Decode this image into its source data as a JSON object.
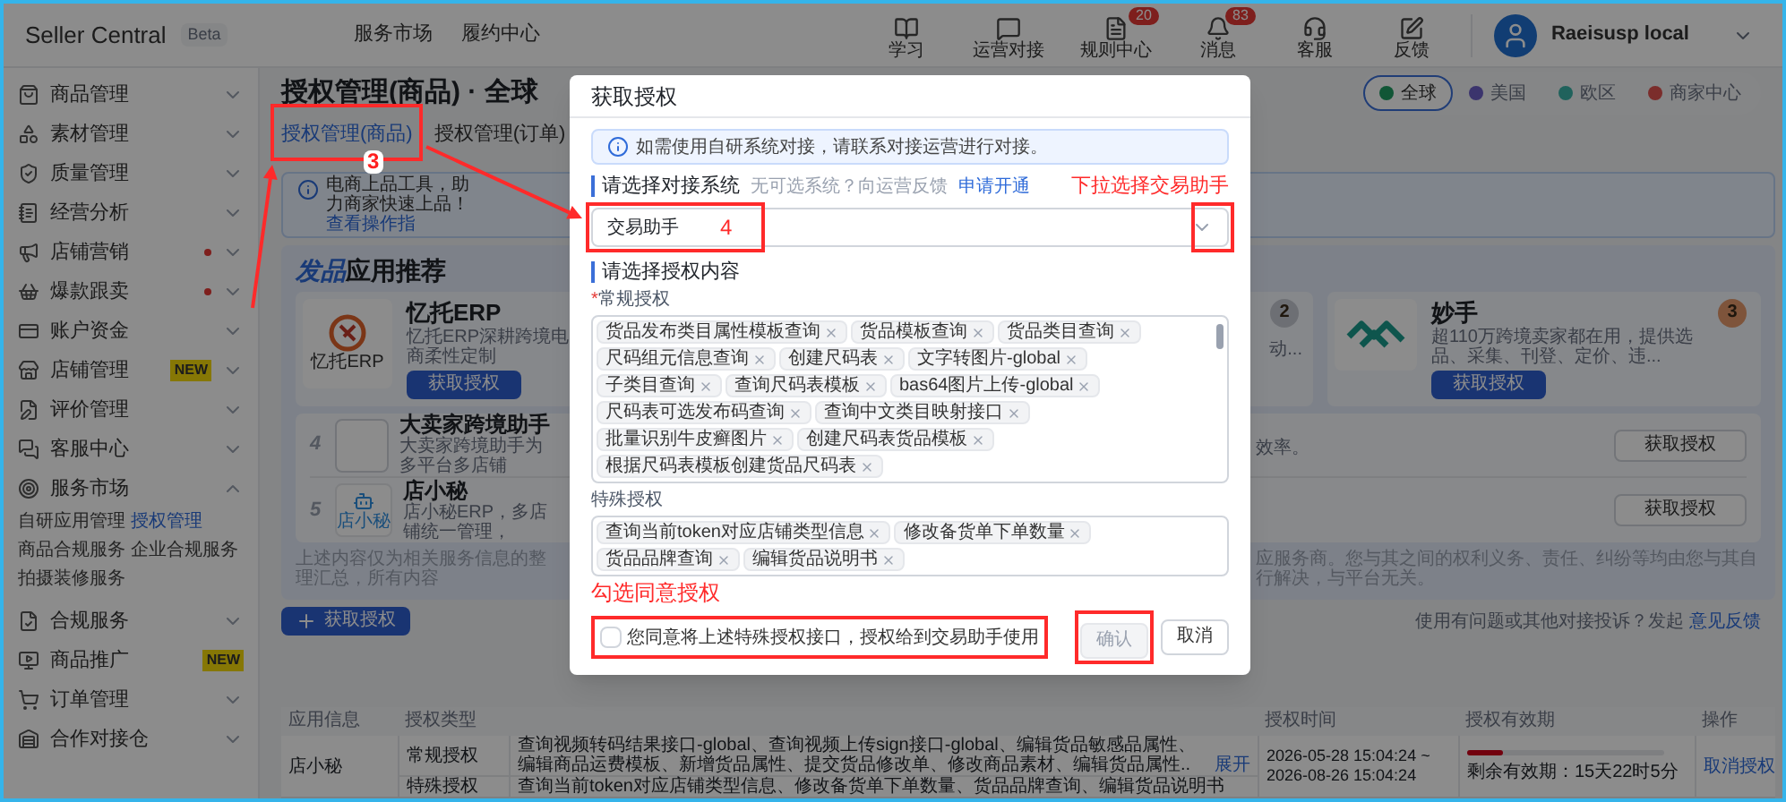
{
  "header": {
    "brand": "Seller Central",
    "brand_tag": "Beta",
    "nav": [
      {
        "label": "服务市场"
      },
      {
        "label": "履约中心"
      }
    ],
    "tools": [
      {
        "kind": "book",
        "label": "学习"
      },
      {
        "kind": "chat",
        "label": "运营对接"
      },
      {
        "kind": "doc",
        "label": "规则中心",
        "count": "20"
      },
      {
        "kind": "bell",
        "label": "消息",
        "count": "83"
      },
      {
        "kind": "support",
        "label": "客服"
      },
      {
        "kind": "edit",
        "label": "反馈"
      }
    ],
    "user": {
      "name": "Raeisusp local"
    }
  },
  "sidebar": {
    "items": [
      {
        "kind": "menu",
        "label": "商品管理",
        "dot": false,
        "expanded": false
      },
      {
        "kind": "menu",
        "label": "素材管理",
        "dot": false,
        "expanded": false
      },
      {
        "kind": "menu",
        "label": "质量管理",
        "dot": false,
        "expanded": false
      },
      {
        "kind": "menu",
        "label": "经营分析",
        "dot": false,
        "expanded": false
      },
      {
        "kind": "menu",
        "label": "店铺营销",
        "dot": true,
        "expanded": false
      },
      {
        "kind": "menu",
        "label": "爆款跟卖",
        "dot": true,
        "expanded": false
      },
      {
        "kind": "menu",
        "label": "账户资金",
        "dot": false,
        "expanded": false
      },
      {
        "kind": "menu",
        "label": "店铺管理",
        "dot": false,
        "tag": "NEW",
        "expanded": false
      },
      {
        "kind": "menu",
        "label": "评价管理",
        "dot": false,
        "expanded": false
      },
      {
        "kind": "menu",
        "label": "客服中心",
        "dot": false,
        "expanded": false
      },
      {
        "kind": "menu",
        "label": "服务市场",
        "dot": false,
        "expanded": true,
        "children": [
          {
            "label": "自研应用管理",
            "selected": false
          },
          {
            "label": "授权管理",
            "selected": true
          },
          {
            "label": "商品合规服务",
            "selected": false
          },
          {
            "label": "企业合规服务",
            "selected": false
          },
          {
            "label": "拍摄装修服务",
            "selected": false
          }
        ]
      },
      {
        "kind": "menu",
        "label": "合规服务",
        "dot": false,
        "expanded": false
      },
      {
        "kind": "link",
        "label": "商品推广",
        "dot": false,
        "tag": "NEW"
      },
      {
        "kind": "menu",
        "label": "订单管理",
        "dot": false,
        "expanded": false
      },
      {
        "kind": "menu",
        "label": "合作对接仓",
        "dot": false,
        "expanded": false
      }
    ]
  },
  "page": {
    "title": "授权管理(商品) · 全球",
    "tabs": [
      {
        "label": "授权管理(商品)",
        "selected": true
      },
      {
        "label": "授权管理(订单)",
        "selected": false
      }
    ],
    "regions": [
      {
        "label": "全球",
        "selected": true
      },
      {
        "label": "美国",
        "selected": false
      },
      {
        "label": "欧区",
        "selected": false
      },
      {
        "label": "商家中心",
        "selected": false
      }
    ],
    "notice": {
      "text": "电商上品工具，助力商家快速上品！",
      "link": "查看操作指"
    },
    "recommend": {
      "title_accent": "发品",
      "title": "应用推荐",
      "featured": [
        {
          "kind": "full",
          "logo_text": "忆托ERP",
          "name": "忆托ERP",
          "description": "忆托ERP深耕跨境电商柔性定制",
          "button": "获取授权"
        },
        {
          "kind": "covered",
          "rank": "2",
          "description": "动..."
        },
        {
          "kind": "full",
          "rank": "3",
          "name": "妙手",
          "description": "超110万跨境卖家都在用，提供选品、采集、刊登、定价、违...",
          "button": "获取授权"
        }
      ],
      "list": [
        {
          "rank": "4",
          "name": "大卖家跨境助手",
          "description": "大卖家跨境助手为多平台多店铺",
          "description_end": "效率。",
          "button": "获取授权"
        },
        {
          "rank": "5",
          "logo_text": "店小秘",
          "name": "店小秘",
          "description": "店小秘ERP，多店铺统一管理，",
          "button": "获取授权"
        }
      ],
      "disclaimer": [
        "上述内容仅为相关服务信息的整理汇总，所有内容",
        "应服务商。您与其之间的权利义务、责任、纠纷等均由您与其自行解决，与平台无关。"
      ]
    },
    "add_button": "获取授权",
    "feedback": {
      "text": "使用有问题或其他对接投诉？发起",
      "link": "意见反馈"
    },
    "table": {
      "columns": [
        {
          "label": "应用信息"
        },
        {
          "label": "授权类型"
        },
        {
          "label": "授权时间"
        },
        {
          "label": "授权有效期"
        },
        {
          "label": "操作"
        }
      ],
      "rows": [
        {
          "app": "店小秘",
          "grants": [
            {
              "type": "常规授权",
              "content": "查询视频转码结果接口-global、查询视频上传sign接口-global、编辑货品敏感品属性、编辑商品运费模板、新增货品属性、提交货品修改单、修改商品素材、编辑货品属性..",
              "expand": "展开"
            },
            {
              "type": "特殊授权",
              "content": "查询当前token对应店铺类型信息、修改备货单下单数量、货品品牌查询、编辑货品说明书"
            }
          ],
          "time_start": "2026-05-28 15:04:24 ~",
          "time_end": "2026-08-26 15:04:24",
          "level": 0.18,
          "remaining": "剩余有效期：15天22时5分",
          "action": "取消授权"
        }
      ]
    }
  },
  "modal": {
    "title": "获取授权",
    "info": "如需使用自研系统对接，请联系对接运营进行对接。",
    "system": {
      "heading": "请选择对接系统",
      "hint": "无可选系统？向运营反馈",
      "link": "申请开通",
      "value": "交易助手"
    },
    "content": {
      "heading": "请选择授权内容",
      "regular": {
        "required_mark": "*",
        "label": "常规授权",
        "tags": [
          "货品发布类目属性模板查询",
          "货品模板查询",
          "货品类目查询",
          "尺码组元信息查询",
          "创建尺码表",
          "文字转图片-global",
          "子类目查询",
          "查询尺码表模板",
          "bas64图片上传-global",
          "尺码表可选发布码查询",
          "查询中文类目映射接口",
          "批量识别牛皮癣图片",
          "创建尺码表货品模板",
          "根据尺码表模板创建货品尺码表"
        ]
      },
      "special": {
        "label": "特殊授权",
        "tags": [
          "查询当前token对应店铺类型信息",
          "修改备货单下单数量",
          "货品品牌查询",
          "编辑货品说明书"
        ]
      }
    },
    "agree": {
      "checked": false,
      "text": "您同意将上述特殊授权接口，授权给到交易助手使用"
    },
    "buttons": [
      {
        "kind": "primary",
        "label": "确认",
        "disabled": true
      },
      {
        "kind": "default",
        "label": "取消",
        "disabled": false
      }
    ]
  },
  "annotations": {
    "tab_step": "3",
    "select_step": "4",
    "dropdown_note": "下拉选择交易助手",
    "agree_note": "勾选同意授权"
  }
}
